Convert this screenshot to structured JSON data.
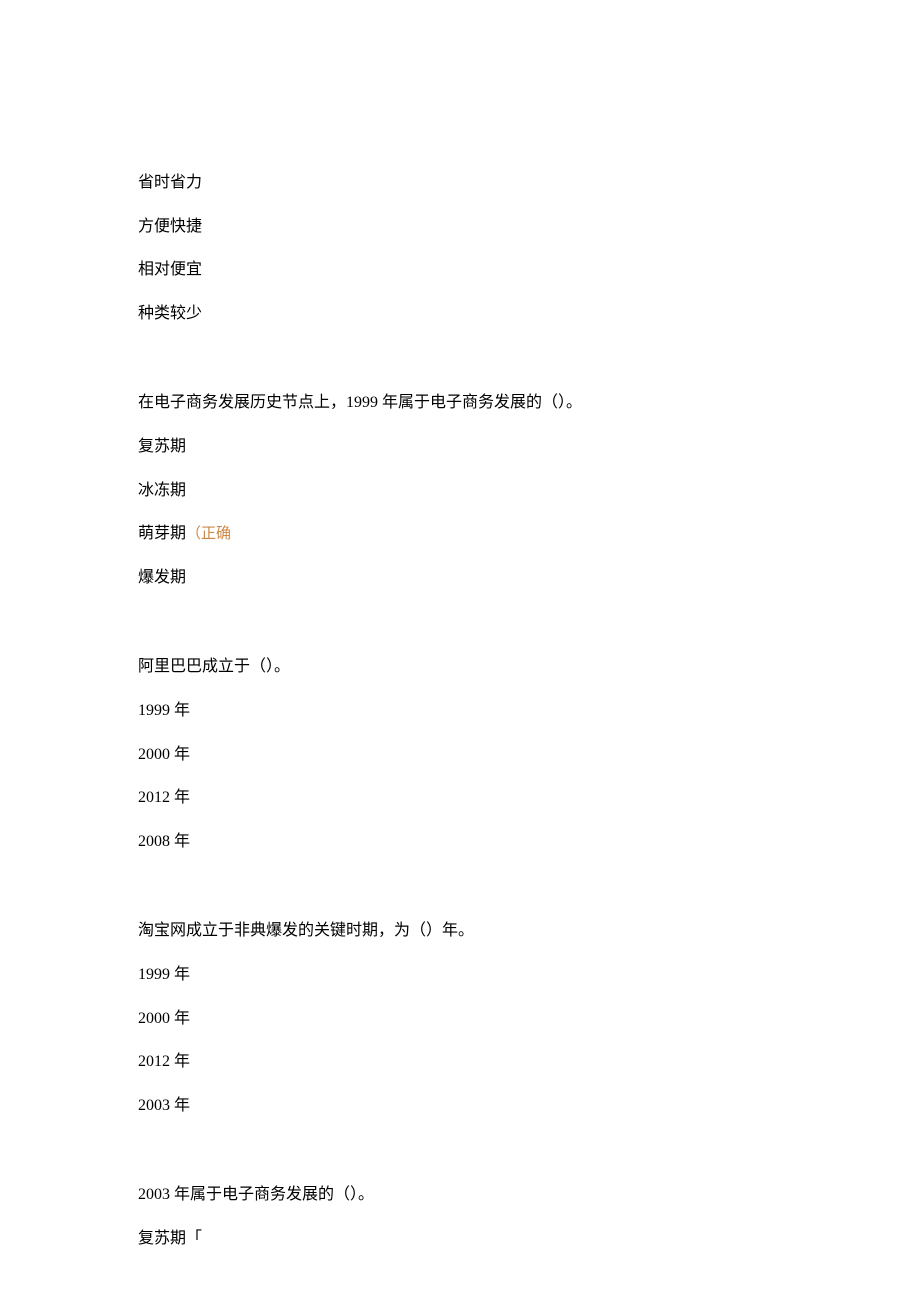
{
  "q1": {
    "options": [
      "省时省力",
      "方便快捷",
      "相对便宜",
      "种类较少"
    ]
  },
  "q2": {
    "question": "在电子商务发展历史节点上，1999 年属于电子商务发展的（）。",
    "options": [
      "复苏期",
      "冰冻期",
      "萌芽期",
      "爆发期"
    ],
    "annotation": "（正确"
  },
  "q3": {
    "question": "阿里巴巴成立于（）。",
    "options": [
      "1999 年",
      "2000 年",
      "2012 年",
      "2008 年"
    ]
  },
  "q4": {
    "question": "淘宝网成立于非典爆发的关键时期，为（）年。",
    "options": [
      "1999 年",
      "2000 年",
      "2012 年",
      "2003 年"
    ]
  },
  "q5": {
    "question": "2003 年属于电子商务发展的（）。",
    "options": [
      "复苏期「"
    ]
  }
}
